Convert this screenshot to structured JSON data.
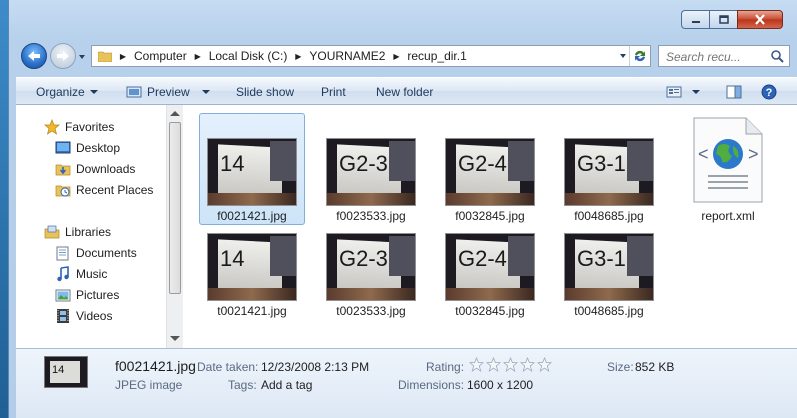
{
  "address": {
    "crumbs": [
      "Computer",
      "Local Disk (C:)",
      "YOURNAME2",
      "recup_dir.1"
    ]
  },
  "search": {
    "placeholder": "Search recu..."
  },
  "toolbar": {
    "organize": "Organize",
    "preview": "Preview",
    "slideshow": "Slide show",
    "print": "Print",
    "newfolder": "New folder"
  },
  "nav": {
    "favorites": "Favorites",
    "desktop": "Desktop",
    "downloads": "Downloads",
    "recent": "Recent Places",
    "libraries": "Libraries",
    "documents": "Documents",
    "music": "Music",
    "pictures": "Pictures",
    "videos": "Videos"
  },
  "files": [
    {
      "name": "f0021421.jpg",
      "label": "14",
      "selected": true
    },
    {
      "name": "f0023533.jpg",
      "label": "G2-3"
    },
    {
      "name": "f0032845.jpg",
      "label": "G2-4"
    },
    {
      "name": "f0048685.jpg",
      "label": "G3-1"
    },
    {
      "name": "report.xml",
      "label": ""
    },
    {
      "name": "t0021421.jpg",
      "label": "14"
    },
    {
      "name": "t0023533.jpg",
      "label": "G2-3"
    },
    {
      "name": "t0032845.jpg",
      "label": "G2-4"
    },
    {
      "name": "t0048685.jpg",
      "label": "G3-1"
    }
  ],
  "details": {
    "thumb_label": "14",
    "filename": "f0021421.jpg",
    "filetype": "JPEG image",
    "date_label": "Date taken:",
    "date_value": "12/23/2008 2:13 PM",
    "tags_label": "Tags:",
    "tags_value": "Add a tag",
    "rating_label": "Rating:",
    "rating_value": 0,
    "dimensions_label": "Dimensions:",
    "dimensions_value": "1600 x 1200",
    "size_label": "Size:",
    "size_value": "852 KB"
  },
  "colors": {
    "accent": "#1e395b",
    "selection": "#cde4f8",
    "close": "#c74a2f"
  }
}
